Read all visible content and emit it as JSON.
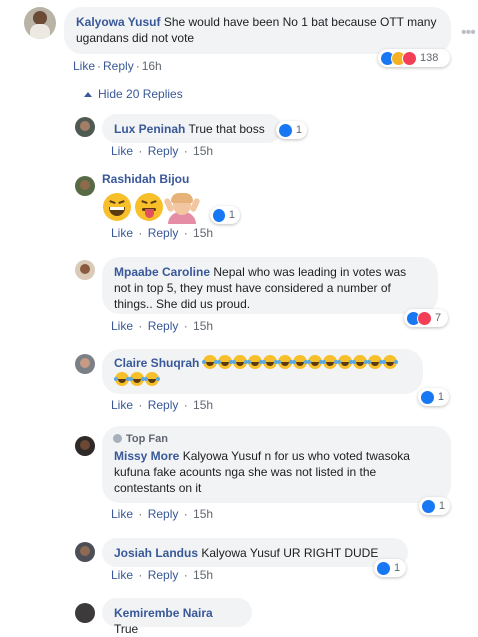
{
  "colors": {
    "link": "#385898",
    "bubble": "#f2f3f5",
    "like": "#1877f2",
    "haha": "#f7b125",
    "love": "#f33e58"
  },
  "more_icon": "•••",
  "hide_replies": "Hide 20 Replies",
  "comments": [
    {
      "author": "Kalyowa Yusuf",
      "text": "She would have been No 1 bat because OTT many ugandans did not vote",
      "like": "Like",
      "reply": "Reply",
      "time": "16h",
      "reactions": [
        "like",
        "haha",
        "love"
      ],
      "count": "138"
    },
    {
      "author": "Lux Peninah",
      "text": "True that boss",
      "like": "Like",
      "reply": "Reply",
      "time": "15h",
      "reactions": [
        "like"
      ],
      "count": "1"
    },
    {
      "author": "Rashidah Bijou",
      "text": "",
      "emojis": [
        "grinning-squinting-face",
        "face-with-tongue",
        "person-gesturing-ok"
      ],
      "like": "Like",
      "reply": "Reply",
      "time": "15h",
      "reactions": [
        "like"
      ],
      "count": "1"
    },
    {
      "author": "Mpaabe Caroline",
      "text": "Nepal who was leading in votes was not in top 5, they must have considered a number of things.. She did us proud.",
      "like": "Like",
      "reply": "Reply",
      "time": "15h",
      "reactions": [
        "like",
        "love"
      ],
      "count": "7"
    },
    {
      "author": "Claire Shuqrah",
      "text": "",
      "emoji_count": 16,
      "emoji": "face-with-tears-of-joy",
      "like": "Like",
      "reply": "Reply",
      "time": "15h",
      "reactions": [
        "like"
      ],
      "count": "1"
    },
    {
      "badge": "Top Fan",
      "author": "Missy More",
      "text": "Kalyowa Yusuf n for us who voted twasoka kufuna fake acounts nga she was not listed in the contestants on it",
      "like": "Like",
      "reply": "Reply",
      "time": "15h",
      "reactions": [
        "like"
      ],
      "count": "1"
    },
    {
      "author": "Josiah Landus",
      "text": "Kalyowa Yusuf UR RIGHT DUDE",
      "like": "Like",
      "reply": "Reply",
      "time": "15h",
      "reactions": [
        "like"
      ],
      "count": "1"
    },
    {
      "author": "Kemirembe Naira",
      "text": "True"
    }
  ]
}
